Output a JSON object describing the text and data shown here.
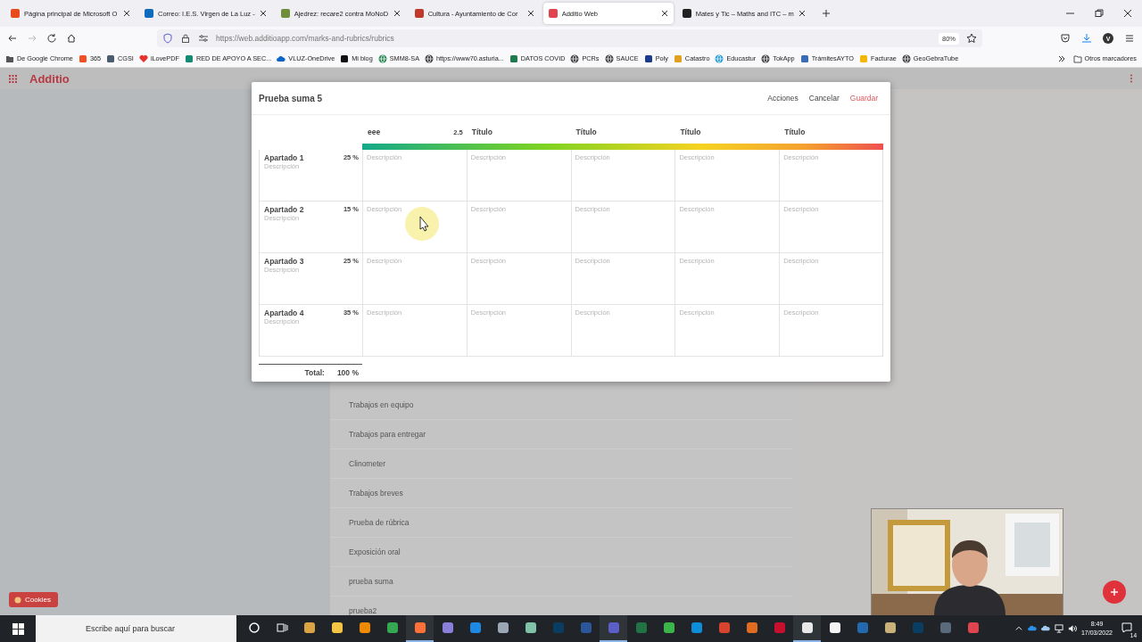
{
  "browser": {
    "tabs": [
      {
        "title": "Página principal de Microsoft O",
        "color": "#e8491d",
        "selected": false
      },
      {
        "title": "Correo: I.E.S. Virgen de La Luz -",
        "color": "#0f6cbd",
        "selected": false
      },
      {
        "title": "Ajedrez: recare2 contra MoNoD",
        "color": "#6f8f3a",
        "selected": false
      },
      {
        "title": "Cultura - Ayuntamiento de Cor",
        "color": "#c0392b",
        "selected": false
      },
      {
        "title": "Additio Web",
        "color": "#e2444f",
        "selected": true
      },
      {
        "title": "Mates y Tic – Maths and ITC – m",
        "color": "#222222",
        "selected": false
      }
    ],
    "url": "https://web.additioapp.com/marks-and-rubrics/rubrics",
    "zoom": "80%",
    "avatar": "V",
    "bookmarks": [
      {
        "label": "De Google Chrome",
        "kind": "folder",
        "color": "#555555"
      },
      {
        "label": "365",
        "kind": "square",
        "color": "#f25022"
      },
      {
        "label": "CGSI",
        "kind": "square",
        "color": "#4a5c6e"
      },
      {
        "label": "iLovePDF",
        "kind": "heart",
        "color": "#e5322d"
      },
      {
        "label": "RED DE APOYO A SEC...",
        "kind": "square",
        "color": "#138a72"
      },
      {
        "label": "VLUZ-OneDrive",
        "kind": "cloud",
        "color": "#0a64c8"
      },
      {
        "label": "Mi blog",
        "kind": "square",
        "color": "#111111"
      },
      {
        "label": "SMM8-SA",
        "kind": "globe",
        "color": "#2e8b57"
      },
      {
        "label": "https://www70.asturia...",
        "kind": "globe",
        "color": "#444444"
      },
      {
        "label": "DATOS COVID",
        "kind": "square",
        "color": "#1e7a4c"
      },
      {
        "label": "PCRs",
        "kind": "globe",
        "color": "#444444"
      },
      {
        "label": "SAUCE",
        "kind": "globe",
        "color": "#444444"
      },
      {
        "label": "Poly",
        "kind": "square",
        "color": "#1b3c8c"
      },
      {
        "label": "Catastro",
        "kind": "square",
        "color": "#e0a020"
      },
      {
        "label": "Educastur",
        "kind": "globe",
        "color": "#2a9fd6"
      },
      {
        "label": "TokApp",
        "kind": "globe",
        "color": "#444444"
      },
      {
        "label": "TrámitesAYTO",
        "kind": "square",
        "color": "#3b6bb5"
      },
      {
        "label": "Facturae",
        "kind": "square",
        "color": "#f2b705"
      },
      {
        "label": "GeoGebraTube",
        "kind": "globe",
        "color": "#444444"
      }
    ],
    "other_bookmarks": "Otros marcadores"
  },
  "app": {
    "name": "Additio",
    "list": [
      "Trabajos en equipo",
      "Trabajos para entregar",
      "Clinometer",
      "Trabajos breves",
      "Prueba de rúbrica",
      "Exposición oral",
      "prueba suma",
      "prueba2"
    ],
    "cookies": "Cookies"
  },
  "dialog": {
    "title": "Prueba suma 5",
    "actions": [
      {
        "label": "Acciones",
        "kind": "link"
      },
      {
        "label": "Cancelar",
        "kind": "link"
      },
      {
        "label": "Guardar",
        "kind": "primary"
      }
    ],
    "levels": [
      {
        "title": "eee",
        "score": "2.5"
      },
      {
        "title": "Título"
      },
      {
        "title": "Título"
      },
      {
        "title": "Título"
      },
      {
        "title": "Título"
      }
    ],
    "rows": [
      {
        "name": "Apartado 1",
        "weight": "25 %",
        "placeholder": "Descripción",
        "cells": [
          {
            "placeholder": "Descripción"
          },
          {
            "placeholder": "Descripción"
          },
          {
            "placeholder": "Descripción"
          },
          {
            "placeholder": "Descripción"
          },
          {
            "placeholder": "Descripción"
          }
        ]
      },
      {
        "name": "Apartado 2",
        "weight": "15 %",
        "placeholder": "Descripción",
        "cells": [
          {
            "placeholder": "Descripción"
          },
          {
            "placeholder": "Descripción"
          },
          {
            "placeholder": "Descripción"
          },
          {
            "placeholder": "Descripción"
          },
          {
            "placeholder": "Descripción"
          }
        ]
      },
      {
        "name": "Apartado 3",
        "weight": "25 %",
        "placeholder": "Descripción",
        "cells": [
          {
            "placeholder": "Descripción"
          },
          {
            "placeholder": "Descripción"
          },
          {
            "placeholder": "Descripción"
          },
          {
            "placeholder": "Descripción"
          },
          {
            "placeholder": "Descripción"
          }
        ]
      },
      {
        "name": "Apartado 4",
        "weight": "35 %",
        "placeholder": "Descripción",
        "cells": [
          {
            "placeholder": "Descripción"
          },
          {
            "placeholder": "Descripción"
          },
          {
            "placeholder": "Descripción"
          },
          {
            "placeholder": "Descripción"
          },
          {
            "placeholder": "Descripción"
          }
        ]
      }
    ],
    "total_label": "Total:",
    "total": "100 %"
  },
  "taskbar": {
    "search_placeholder": "Escribe aquí para buscar",
    "apps": [
      {
        "kind": "ring",
        "running": false
      },
      {
        "kind": "taskview",
        "running": false
      },
      {
        "kind": "app",
        "color": "#d9a441",
        "running": false
      },
      {
        "kind": "app",
        "color": "#f4c542",
        "running": false
      },
      {
        "kind": "app",
        "color": "#f08a00",
        "running": false
      },
      {
        "kind": "app",
        "color": "#34a853",
        "running": false
      },
      {
        "kind": "app",
        "color": "#ff7139",
        "running": true
      },
      {
        "kind": "app",
        "color": "#8a7fd9",
        "running": false
      },
      {
        "kind": "app",
        "color": "#1e88e5",
        "running": false
      },
      {
        "kind": "app",
        "color": "#9aa7b5",
        "running": false
      },
      {
        "kind": "app",
        "color": "#7fc3a8",
        "running": false
      },
      {
        "kind": "app",
        "color": "#0a3d62",
        "running": false
      },
      {
        "kind": "app",
        "color": "#2b579a",
        "running": false
      },
      {
        "kind": "app",
        "color": "#5b5fc7",
        "running": true
      },
      {
        "kind": "app",
        "color": "#217346",
        "running": false
      },
      {
        "kind": "app",
        "color": "#3bb54a",
        "running": false
      },
      {
        "kind": "app",
        "color": "#0c8ed9",
        "running": false
      },
      {
        "kind": "app",
        "color": "#d8432e",
        "running": false
      },
      {
        "kind": "app",
        "color": "#e06c1f",
        "running": false
      },
      {
        "kind": "app",
        "color": "#c8102e",
        "running": false
      },
      {
        "kind": "app",
        "color": "#e8e8e8",
        "running": true
      },
      {
        "kind": "app",
        "color": "#f4f4f4",
        "running": false
      },
      {
        "kind": "app",
        "color": "#2468b0",
        "running": false
      },
      {
        "kind": "app",
        "color": "#c9b27a",
        "running": false
      },
      {
        "kind": "app",
        "color": "#0a3d62",
        "running": false
      },
      {
        "kind": "app",
        "color": "#5a6a7a",
        "running": false
      },
      {
        "kind": "app",
        "color": "#e2444f",
        "running": false
      }
    ],
    "time": "8:49",
    "date": "17/03/2022",
    "notifications": "14"
  }
}
